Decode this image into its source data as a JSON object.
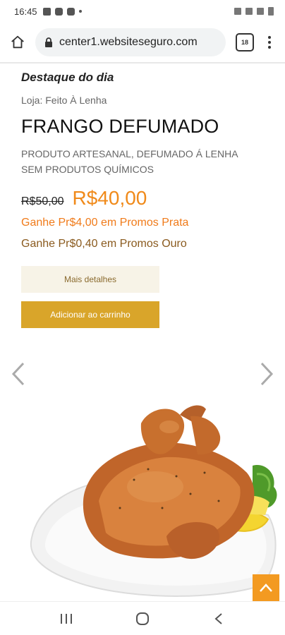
{
  "status_bar": {
    "time": "16:45"
  },
  "browser": {
    "url": "center1.websiteseguro.com",
    "tab_count": "18"
  },
  "product": {
    "highlight_label": "Destaque do dia",
    "store": "Loja: Feito À Lenha",
    "title": "FRANGO DEFUMADO",
    "description_line1": "PRODUTO ARTESANAL, DEFUMADO Á LENHA",
    "description_line2": "SEM PRODUTOS QUÍMICOS",
    "old_price": "R$50,00",
    "new_price": "R$40,00",
    "promo_silver": "Ganhe Pr$4,00 em Promos Prata",
    "promo_gold": "Ganhe Pr$0,40 em Promos Ouro",
    "details_button": "Mais detalhes",
    "cart_button": "Adicionar ao carrinho"
  },
  "colors": {
    "price_orange": "#f08a1a",
    "cart_gold": "#d9a52a",
    "scroll_top_orange": "#f39a21"
  },
  "icons": {
    "home": "home-icon",
    "lock": "lock-icon",
    "menu": "more-vert-icon",
    "carousel_prev": "chevron-left-icon",
    "carousel_next": "chevron-right-icon",
    "scroll_top": "chevron-up-icon",
    "nav_recents": "recents-icon",
    "nav_home": "circle-home-icon",
    "nav_back": "back-icon"
  }
}
